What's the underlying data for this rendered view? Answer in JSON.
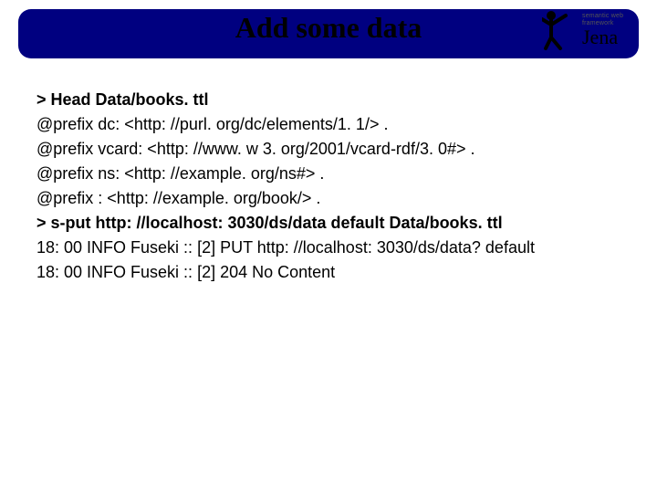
{
  "title": "Add some data",
  "logo": {
    "tagline1": "semantic web",
    "tagline2": "framework",
    "name": "Jena"
  },
  "lines": {
    "l0": "> Head Data/books. ttl",
    "l1": "@prefix dc: <http: //purl. org/dc/elements/1. 1/> .",
    "l2": "@prefix vcard: <http: //www. w 3. org/2001/vcard-rdf/3. 0#> .",
    "l3": "@prefix ns: <http: //example. org/ns#> .",
    "l4": "@prefix : <http: //example. org/book/> .",
    "l5": "> s-put http: //localhost: 3030/ds/data default Data/books. ttl",
    "l6": "18: 00 INFO Fuseki  :: [2] PUT http: //localhost: 3030/ds/data? default",
    "l7": "18: 00 INFO Fuseki  :: [2] 204 No Content"
  }
}
